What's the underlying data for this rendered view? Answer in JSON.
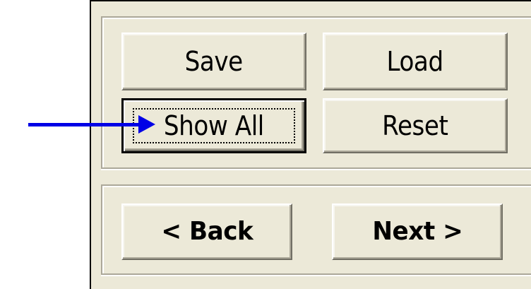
{
  "dialog": {
    "top_group": {
      "save_label": "Save",
      "load_label": "Load",
      "show_all_label": "Show All",
      "reset_label": "Reset"
    },
    "nav_group": {
      "back_label": "< Back",
      "next_label": "Next >"
    }
  },
  "annotation": {
    "arrow_color": "#0000e6",
    "points_to": "show-all-button"
  },
  "colors": {
    "dialog_background": "#ece9d8",
    "page_background": "#ffffff"
  }
}
